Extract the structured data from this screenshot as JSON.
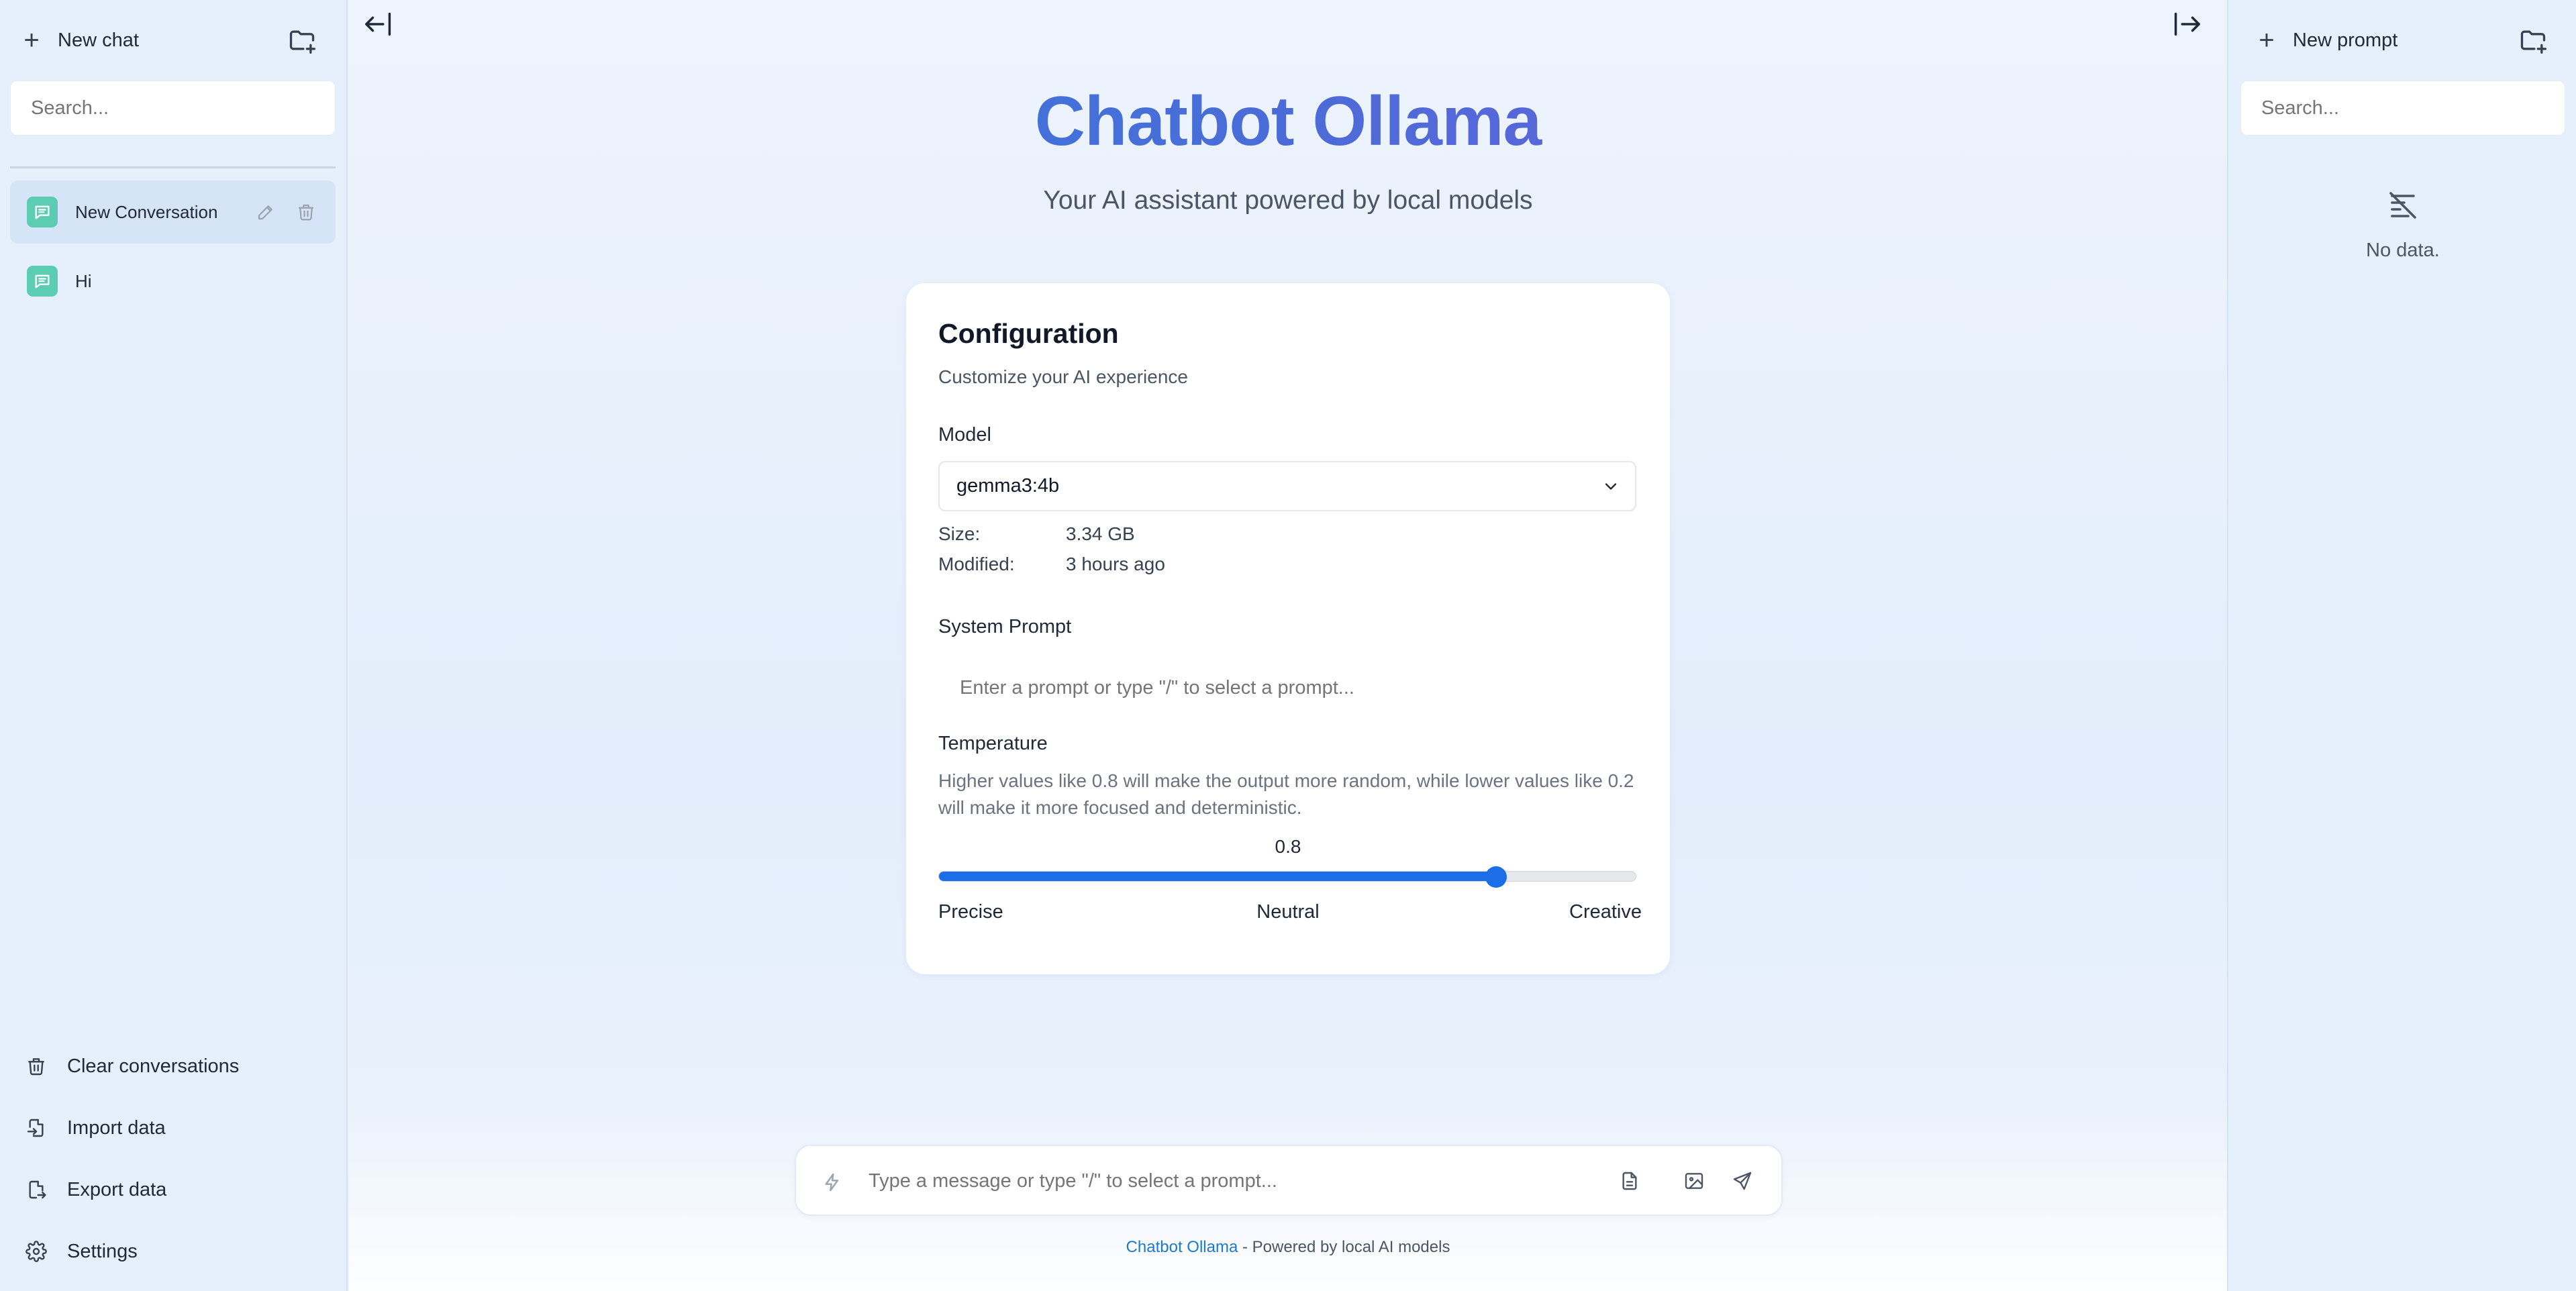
{
  "left_sidebar": {
    "new_chat_label": "New chat",
    "search_placeholder": "Search...",
    "conversations": [
      {
        "label": "New Conversation",
        "active": true
      },
      {
        "label": "Hi",
        "active": false
      }
    ],
    "bottom_items": [
      {
        "label": "Clear conversations",
        "icon": "trash-icon"
      },
      {
        "label": "Import data",
        "icon": "file-import-icon"
      },
      {
        "label": "Export data",
        "icon": "file-export-icon"
      },
      {
        "label": "Settings",
        "icon": "gear-icon"
      }
    ]
  },
  "main": {
    "title": "Chatbot Ollama",
    "subtitle": "Your AI assistant powered by local models",
    "config": {
      "title": "Configuration",
      "subtitle": "Customize your AI experience",
      "model_label": "Model",
      "model_value": "gemma3:4b",
      "size_label": "Size:",
      "size_value": "3.34 GB",
      "modified_label": "Modified:",
      "modified_value": "3 hours ago",
      "system_prompt_label": "System Prompt",
      "system_prompt_placeholder": "Enter a prompt or type \"/\" to select a prompt...",
      "temperature_label": "Temperature",
      "temperature_desc": "Higher values like 0.8 will make the output more random, while lower values like 0.2 will make it more focused and deterministic.",
      "temperature_value": "0.8",
      "temperature_fraction": 0.8,
      "slider_labels": {
        "left": "Precise",
        "middle": "Neutral",
        "right": "Creative"
      }
    },
    "chat_input_placeholder": "Type a message or type \"/\" to select a prompt...",
    "footer": {
      "link": "Chatbot Ollama",
      "text": " - Powered by local AI models"
    }
  },
  "right_sidebar": {
    "new_prompt_label": "New prompt",
    "search_placeholder": "Search...",
    "empty_text": "No data."
  },
  "colors": {
    "accent": "#1b6ee8",
    "conversation_icon": "#5ccdb3",
    "title_gradient_start": "#2d7fdc",
    "title_gradient_end": "#7a5cdd"
  }
}
